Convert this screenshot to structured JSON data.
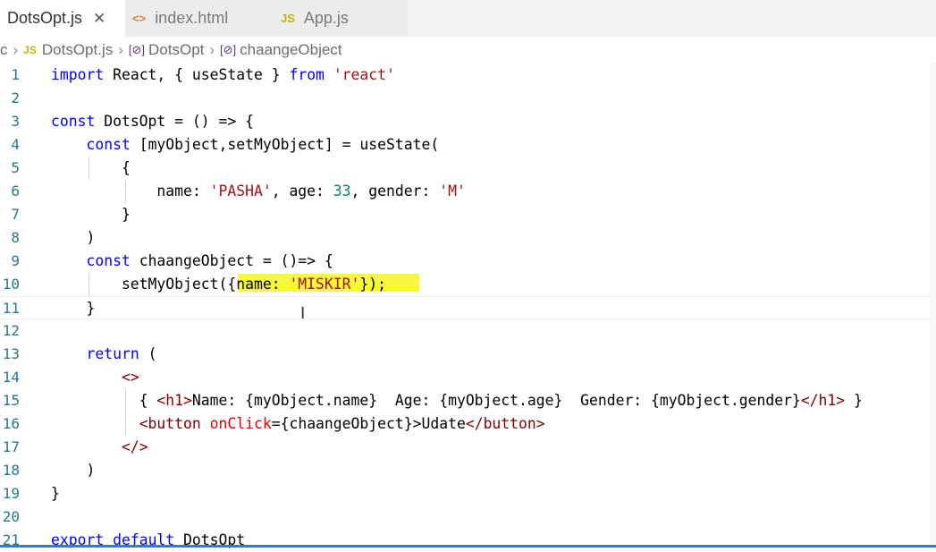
{
  "tabs": [
    {
      "label": "DotsOpt.js",
      "icon": "JS",
      "active": true,
      "close": "✕"
    },
    {
      "label": "index.html",
      "icon": "<>",
      "active": false
    },
    {
      "label": "App.js",
      "icon": "JS",
      "active": false
    }
  ],
  "breadcrumb": {
    "root": "c",
    "file_icon": "JS",
    "file": "DotsOpt.js",
    "symbol_icon": "[⊘]",
    "component": "DotsOpt",
    "method": "chaangeObject"
  },
  "cursor_icon": "I",
  "editor": {
    "lines": [
      {
        "n": "1",
        "code": "import React, { useState } from 'react'"
      },
      {
        "n": "2",
        "code": ""
      },
      {
        "n": "3",
        "code": "const DotsOpt = () => {"
      },
      {
        "n": "4",
        "code": "    const [myObject,setMyObject] = useState("
      },
      {
        "n": "5",
        "code": "        {"
      },
      {
        "n": "6",
        "code": "            name: 'PASHA', age: 33, gender: 'M'"
      },
      {
        "n": "7",
        "code": "        }"
      },
      {
        "n": "8",
        "code": "    )"
      },
      {
        "n": "9",
        "code": "    const chaangeObject = ()=> {"
      },
      {
        "n": "10",
        "code": "        setMyObject({name: 'MISKIR'});"
      },
      {
        "n": "11",
        "code": "    }"
      },
      {
        "n": "12",
        "code": ""
      },
      {
        "n": "13",
        "code": "    return ("
      },
      {
        "n": "14",
        "code": "        <>"
      },
      {
        "n": "15",
        "code": "          { <h1>Name: {myObject.name}  Age: {myObject.age}  Gender: {myObject.gender}</h1> }"
      },
      {
        "n": "16",
        "code": "          <button onClick={chaangeObject}>Udate</button>"
      },
      {
        "n": "17",
        "code": "        </>"
      },
      {
        "n": "18",
        "code": "    )"
      },
      {
        "n": "19",
        "code": "}"
      },
      {
        "n": "20",
        "code": ""
      },
      {
        "n": "21",
        "code": "export default DotsOpt"
      }
    ]
  },
  "colors": {
    "keyword": "#0000ff",
    "string": "#a31515",
    "number": "#098658",
    "tag": "#800000",
    "attribute": "#e50000",
    "line_number": "#237893",
    "highlight": "#f8f83a"
  }
}
